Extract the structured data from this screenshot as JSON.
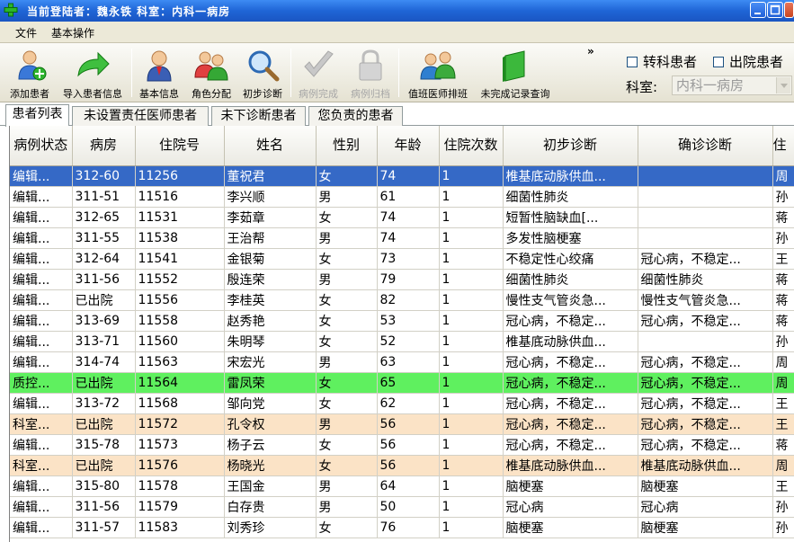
{
  "window": {
    "title": "当前登陆者：魏永铁 科室：内科一病房"
  },
  "menu": [
    "文件",
    "基本操作"
  ],
  "toolbar": {
    "add_patient": "添加患者",
    "import_patient": "导入患者信息",
    "basic_info": "基本信息",
    "role_assign": "角色分配",
    "initial_diagnosis": "初步诊断",
    "case_complete": "病例完成",
    "case_archive": "病例归档",
    "duty_schedule": "值班医师排班",
    "incomplete_query": "未完成记录查询",
    "more": "»"
  },
  "filters": {
    "transfer_label": "转科患者",
    "discharged_label": "出院患者",
    "dept_label": "科室:",
    "dept_value": "内科一病房"
  },
  "tabs": [
    "患者列表",
    "未设置责任医师患者",
    "未下诊断患者",
    "您负责的患者"
  ],
  "table": {
    "headers": [
      "病例状态",
      "病房",
      "住院号",
      "姓名",
      "性别",
      "年龄",
      "住院次数",
      "初步诊断",
      "确诊诊断",
      "住"
    ],
    "rows": [
      {
        "status": "编辑...",
        "ward": "312-60",
        "no": "11256",
        "name": "董祝君",
        "sex": "女",
        "age": "74",
        "times": "1",
        "initial": "椎基底动脉供血...",
        "final": "",
        "extra": "周",
        "style": "selected"
      },
      {
        "status": "编辑...",
        "ward": "311-51",
        "no": "11516",
        "name": "李兴顺",
        "sex": "男",
        "age": "61",
        "times": "1",
        "initial": "细菌性肺炎",
        "final": "",
        "extra": "孙",
        "style": ""
      },
      {
        "status": "编辑...",
        "ward": "312-65",
        "no": "11531",
        "name": "李茹章",
        "sex": "女",
        "age": "74",
        "times": "1",
        "initial": "短暂性脑缺血[...",
        "final": "",
        "extra": "蒋",
        "style": ""
      },
      {
        "status": "编辑...",
        "ward": "311-55",
        "no": "11538",
        "name": "王治帮",
        "sex": "男",
        "age": "74",
        "times": "1",
        "initial": "多发性脑梗塞",
        "final": "",
        "extra": "孙",
        "style": ""
      },
      {
        "status": "编辑...",
        "ward": "312-64",
        "no": "11541",
        "name": "金银菊",
        "sex": "女",
        "age": "73",
        "times": "1",
        "initial": "不稳定性心绞痛",
        "final": "冠心病，不稳定...",
        "extra": "王",
        "style": ""
      },
      {
        "status": "编辑...",
        "ward": "311-56",
        "no": "11552",
        "name": "殷连荣",
        "sex": "男",
        "age": "79",
        "times": "1",
        "initial": "细菌性肺炎",
        "final": "细菌性肺炎",
        "extra": "蒋",
        "style": ""
      },
      {
        "status": "编辑...",
        "ward": "已出院",
        "no": "11556",
        "name": "李桂英",
        "sex": "女",
        "age": "82",
        "times": "1",
        "initial": "慢性支气管炎急...",
        "final": "慢性支气管炎急...",
        "extra": "蒋",
        "style": ""
      },
      {
        "status": "编辑...",
        "ward": "313-69",
        "no": "11558",
        "name": "赵秀艳",
        "sex": "女",
        "age": "53",
        "times": "1",
        "initial": "冠心病，不稳定...",
        "final": "冠心病，不稳定...",
        "extra": "蒋",
        "style": ""
      },
      {
        "status": "编辑...",
        "ward": "313-71",
        "no": "11560",
        "name": "朱明琴",
        "sex": "女",
        "age": "52",
        "times": "1",
        "initial": "椎基底动脉供血...",
        "final": "",
        "extra": "孙",
        "style": ""
      },
      {
        "status": "编辑...",
        "ward": "314-74",
        "no": "11563",
        "name": "宋宏光",
        "sex": "男",
        "age": "63",
        "times": "1",
        "initial": "冠心病，不稳定...",
        "final": "冠心病，不稳定...",
        "extra": "周",
        "style": ""
      },
      {
        "status": "质控...",
        "ward": "已出院",
        "no": "11564",
        "name": "雷凤荣",
        "sex": "女",
        "age": "65",
        "times": "1",
        "initial": "冠心病，不稳定...",
        "final": "冠心病，不稳定...",
        "extra": "周",
        "style": "green"
      },
      {
        "status": "编辑...",
        "ward": "313-72",
        "no": "11568",
        "name": "邹向党",
        "sex": "女",
        "age": "62",
        "times": "1",
        "initial": "冠心病，不稳定...",
        "final": "冠心病，不稳定...",
        "extra": "王",
        "style": ""
      },
      {
        "status": "科室...",
        "ward": "已出院",
        "no": "11572",
        "name": "孔令权",
        "sex": "男",
        "age": "56",
        "times": "1",
        "initial": "冠心病，不稳定...",
        "final": "冠心病，不稳定...",
        "extra": "王",
        "style": "peach"
      },
      {
        "status": "编辑...",
        "ward": "315-78",
        "no": "11573",
        "name": "杨子云",
        "sex": "女",
        "age": "56",
        "times": "1",
        "initial": "冠心病，不稳定...",
        "final": "冠心病，不稳定...",
        "extra": "蒋",
        "style": ""
      },
      {
        "status": "科室...",
        "ward": "已出院",
        "no": "11576",
        "name": "杨晓光",
        "sex": "女",
        "age": "56",
        "times": "1",
        "initial": "椎基底动脉供血...",
        "final": "椎基底动脉供血...",
        "extra": "周",
        "style": "peach"
      },
      {
        "status": "编辑...",
        "ward": "315-80",
        "no": "11578",
        "name": "王国金",
        "sex": "男",
        "age": "64",
        "times": "1",
        "initial": "脑梗塞",
        "final": "脑梗塞",
        "extra": "王",
        "style": ""
      },
      {
        "status": "编辑...",
        "ward": "311-56",
        "no": "11579",
        "name": "白存贵",
        "sex": "男",
        "age": "50",
        "times": "1",
        "initial": "冠心病",
        "final": "冠心病",
        "extra": "孙",
        "style": ""
      },
      {
        "status": "编辑...",
        "ward": "311-57",
        "no": "11583",
        "name": "刘秀珍",
        "sex": "女",
        "age": "76",
        "times": "1",
        "initial": "脑梗塞",
        "final": "脑梗塞",
        "extra": "孙",
        "style": ""
      }
    ]
  }
}
